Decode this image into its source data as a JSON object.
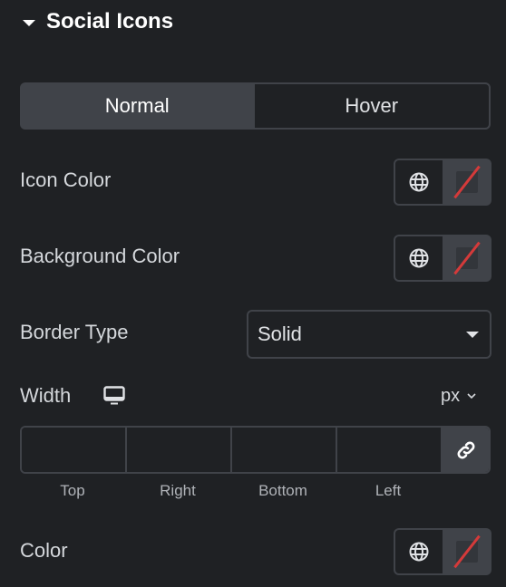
{
  "section": {
    "title": "Social Icons",
    "expanded": true
  },
  "tabs": [
    {
      "label": "Normal",
      "active": true
    },
    {
      "label": "Hover",
      "active": false
    }
  ],
  "controls": {
    "icon_color": {
      "label": "Icon Color",
      "global_icon": "globe-icon",
      "value": "none"
    },
    "background_color": {
      "label": "Background Color",
      "global_icon": "globe-icon",
      "value": "none"
    },
    "border_type": {
      "label": "Border Type",
      "selected": "Solid"
    },
    "width": {
      "label": "Width",
      "device_icon": "desktop-monitor-icon",
      "unit": "px",
      "fields": [
        {
          "label": "Top",
          "value": ""
        },
        {
          "label": "Right",
          "value": ""
        },
        {
          "label": "Bottom",
          "value": ""
        },
        {
          "label": "Left",
          "value": ""
        }
      ],
      "link_icon": "link-icon"
    },
    "color": {
      "label": "Color",
      "global_icon": "globe-icon",
      "value": "none"
    }
  },
  "colors": {
    "panel_bg": "#1f2124",
    "control_bg": "#404349",
    "unset_slash": "#d43a3a"
  }
}
